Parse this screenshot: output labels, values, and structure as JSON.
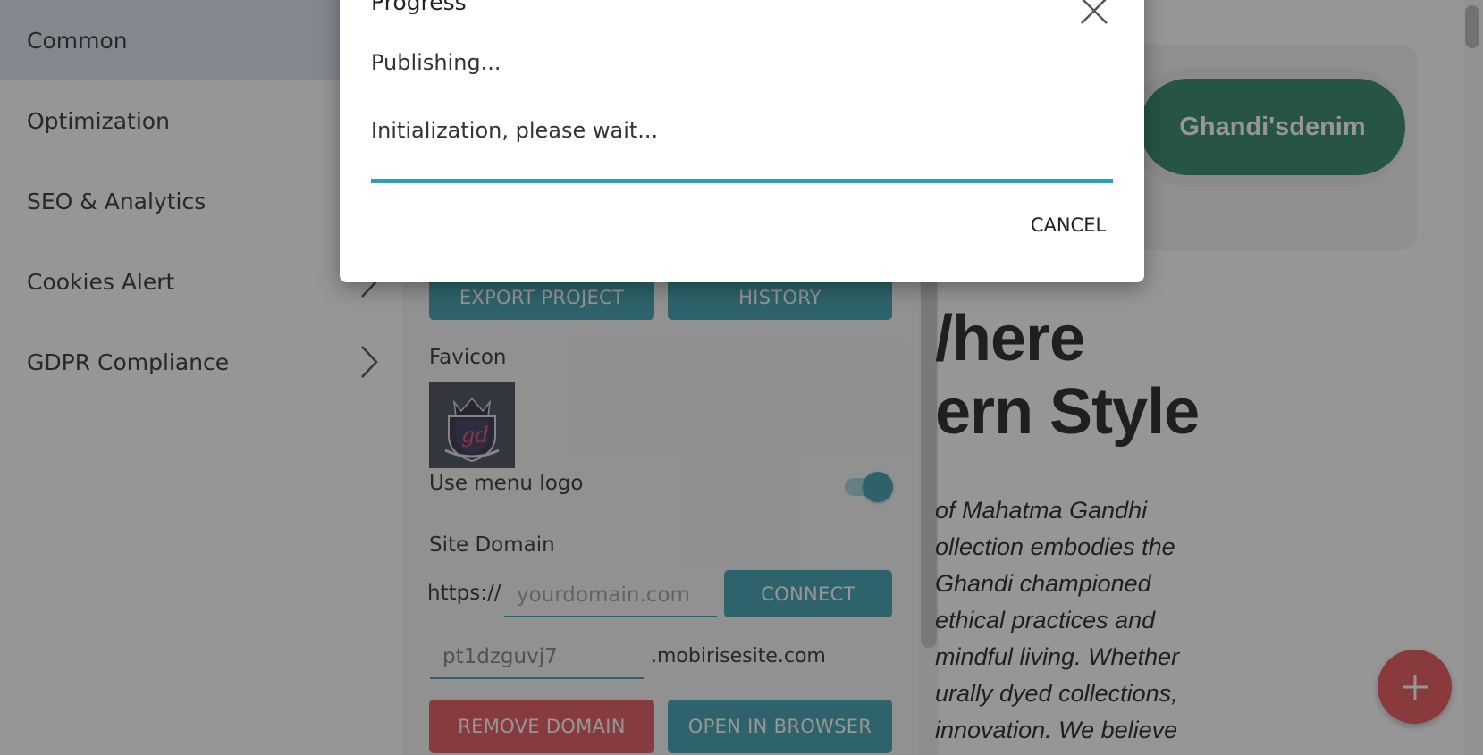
{
  "sidebar": {
    "items": [
      {
        "label": "Common",
        "active": true
      },
      {
        "label": "Optimization"
      },
      {
        "label": "SEO & Analytics"
      },
      {
        "label": "Cookies Alert",
        "icon": "chevron-right-icon"
      },
      {
        "label": "GDPR Compliance",
        "icon": "chevron-right-icon"
      }
    ]
  },
  "panel": {
    "export_label": "EXPORT PROJECT",
    "history_label": "HISTORY",
    "favicon_label": "Favicon",
    "favicon_image": "gd-crest-logo",
    "menu_logo_label": "Use menu logo",
    "menu_logo_on": true,
    "site_domain_label": "Site Domain",
    "protocol_prefix": "https://",
    "domain_placeholder": "yourdomain.com",
    "connect_label": "CONNECT",
    "subdomain_value": "pt1dzguvj7",
    "subdomain_suffix": ".mobirisesite.com",
    "remove_domain_label": "REMOVE DOMAIN",
    "open_browser_label": "OPEN IN BROWSER"
  },
  "preview": {
    "brand": "Ghandi'sdenim",
    "hero_lines": [
      "/here",
      "ern Style"
    ],
    "body_lines": [
      "of Mahatma Gandhi",
      "ollection embodies the",
      "Ghandi championed",
      "ethical practices and",
      "mindful living. Whether",
      "urally dyed collections,",
      "innovation. We believe"
    ],
    "fab_icon": "plus-icon"
  },
  "dialog": {
    "title": "Progress",
    "status": "Publishing...",
    "message": "Initialization, please wait...",
    "cancel_label": "CANCEL",
    "close_icon": "close-icon",
    "progress_fraction": 1.0
  },
  "colors": {
    "accent_teal": "#2f98a8",
    "danger_red": "#e2494f",
    "brand_green": "#1f7a60"
  }
}
